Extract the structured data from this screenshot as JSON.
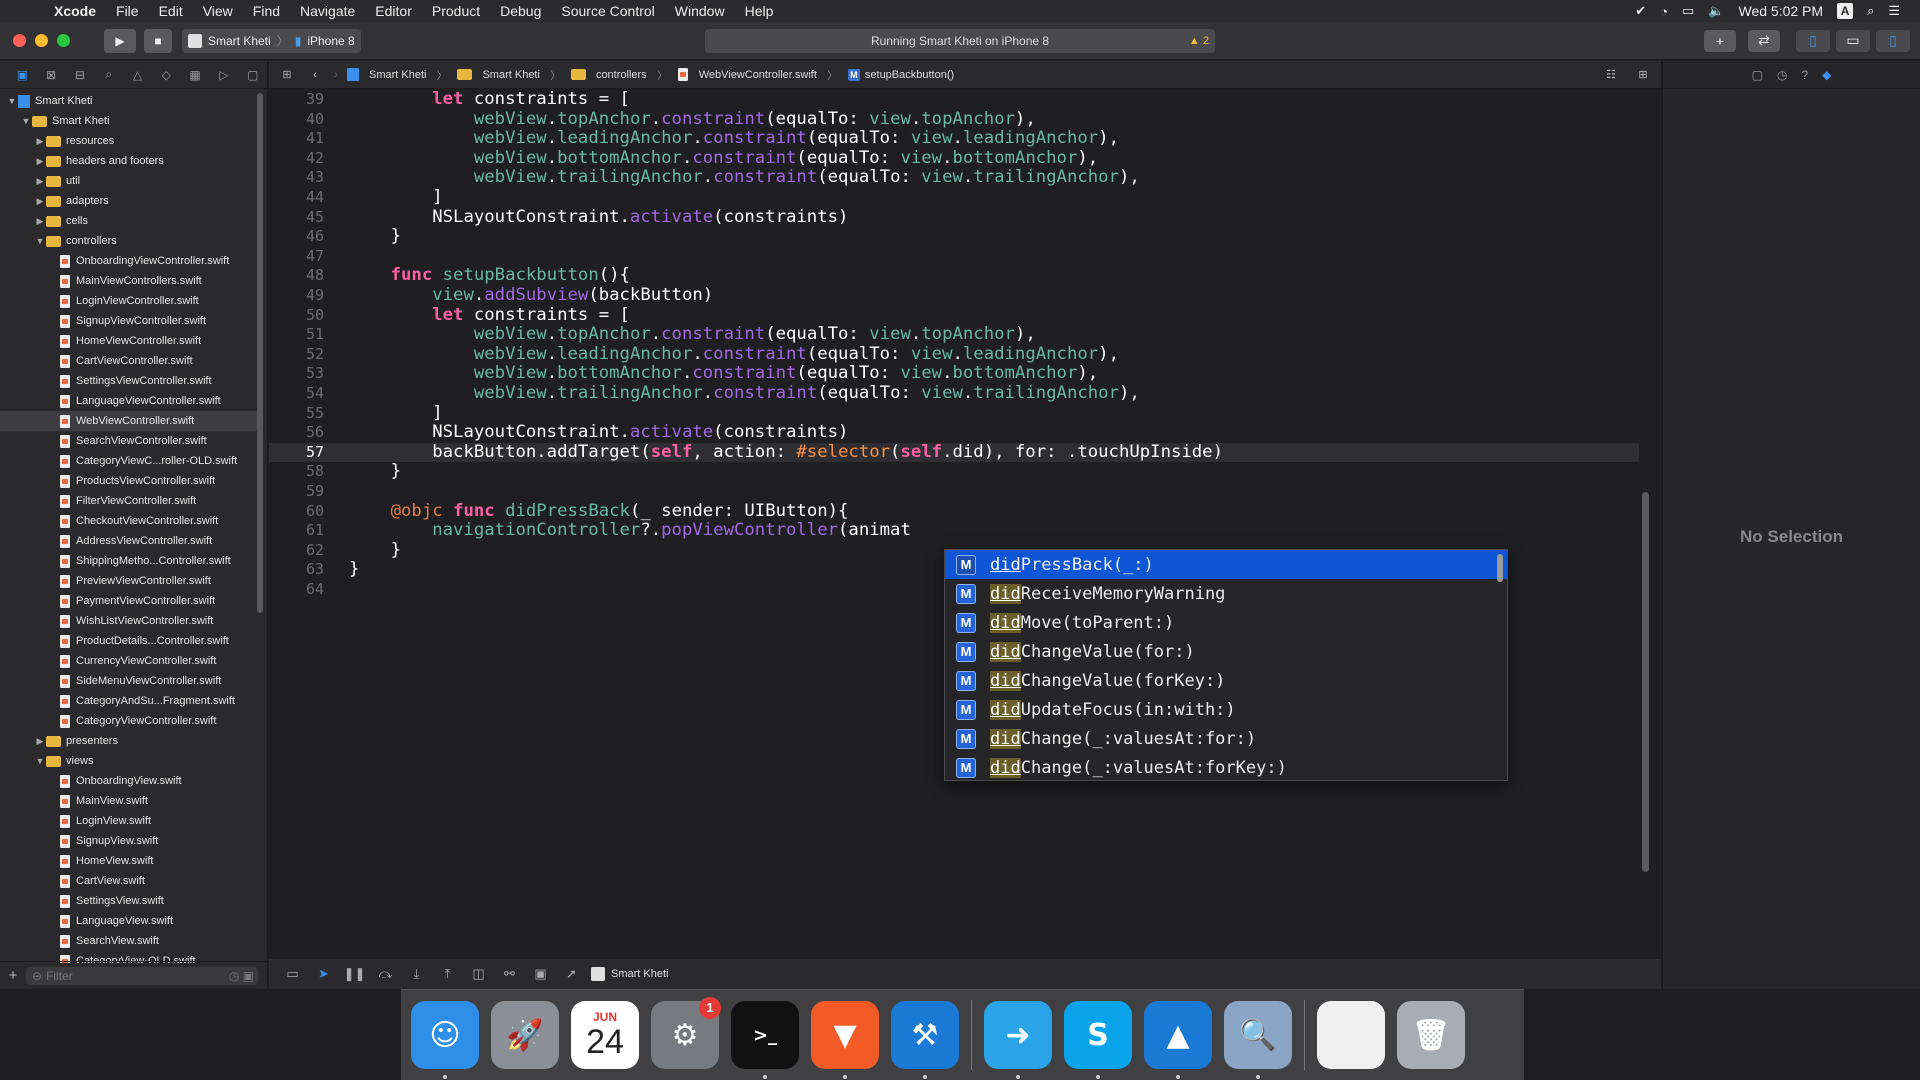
{
  "menubar": {
    "items": [
      "Xcode",
      "File",
      "Edit",
      "View",
      "Find",
      "Navigate",
      "Editor",
      "Product",
      "Debug",
      "Source Control",
      "Window",
      "Help"
    ],
    "clock": "Wed 5:02 PM",
    "input_source": "A"
  },
  "toolbar": {
    "scheme": "Smart Kheti",
    "device": "iPhone 8",
    "status": "Running Smart Kheti on iPhone 8",
    "warnings": "2"
  },
  "jumpbar": {
    "crumbs": [
      "Smart Kheti",
      "Smart Kheti",
      "controllers",
      "WebViewController.swift",
      "setupBackbutton()"
    ]
  },
  "navigator": {
    "tree": [
      {
        "label": "Smart Kheti",
        "kind": "project",
        "depth": 0,
        "open": true
      },
      {
        "label": "Smart Kheti",
        "kind": "folder",
        "depth": 1,
        "open": true
      },
      {
        "label": "resources",
        "kind": "folder",
        "depth": 2,
        "open": false
      },
      {
        "label": "headers and footers",
        "kind": "folder",
        "depth": 2,
        "open": false
      },
      {
        "label": "util",
        "kind": "folder",
        "depth": 2,
        "open": false
      },
      {
        "label": "adapters",
        "kind": "folder",
        "depth": 2,
        "open": false
      },
      {
        "label": "cells",
        "kind": "folder",
        "depth": 2,
        "open": false
      },
      {
        "label": "controllers",
        "kind": "folder",
        "depth": 2,
        "open": true
      },
      {
        "label": "OnboardingViewController.swift",
        "kind": "file",
        "depth": 3
      },
      {
        "label": "MainViewControllers.swift",
        "kind": "file",
        "depth": 3
      },
      {
        "label": "LoginViewController.swift",
        "kind": "file",
        "depth": 3
      },
      {
        "label": "SignupViewController.swift",
        "kind": "file",
        "depth": 3
      },
      {
        "label": "HomeViewController.swift",
        "kind": "file",
        "depth": 3
      },
      {
        "label": "CartViewController.swift",
        "kind": "file",
        "depth": 3
      },
      {
        "label": "SettingsViewController.swift",
        "kind": "file",
        "depth": 3
      },
      {
        "label": "LanguageViewController.swift",
        "kind": "file",
        "depth": 3
      },
      {
        "label": "WebViewController.swift",
        "kind": "file",
        "depth": 3,
        "selected": true
      },
      {
        "label": "SearchViewController.swift",
        "kind": "file",
        "depth": 3
      },
      {
        "label": "CategoryViewC...roller-OLD.swift",
        "kind": "file",
        "depth": 3
      },
      {
        "label": "ProductsViewController.swift",
        "kind": "file",
        "depth": 3
      },
      {
        "label": "FilterViewController.swift",
        "kind": "file",
        "depth": 3
      },
      {
        "label": "CheckoutViewController.swift",
        "kind": "file",
        "depth": 3
      },
      {
        "label": "AddressViewController.swift",
        "kind": "file",
        "depth": 3
      },
      {
        "label": "ShippingMetho...Controller.swift",
        "kind": "file",
        "depth": 3
      },
      {
        "label": "PreviewViewController.swift",
        "kind": "file",
        "depth": 3
      },
      {
        "label": "PaymentViewController.swift",
        "kind": "file",
        "depth": 3
      },
      {
        "label": "WishListViewController.swift",
        "kind": "file",
        "depth": 3
      },
      {
        "label": "ProductDetails...Controller.swift",
        "kind": "file",
        "depth": 3
      },
      {
        "label": "CurrencyViewController.swift",
        "kind": "file",
        "depth": 3
      },
      {
        "label": "SideMenuViewController.swift",
        "kind": "file",
        "depth": 3
      },
      {
        "label": "CategoryAndSu...Fragment.swift",
        "kind": "file",
        "depth": 3
      },
      {
        "label": "CategoryViewController.swift",
        "kind": "file",
        "depth": 3
      },
      {
        "label": "presenters",
        "kind": "folder",
        "depth": 2,
        "open": false
      },
      {
        "label": "views",
        "kind": "folder",
        "depth": 2,
        "open": true
      },
      {
        "label": "OnboardingView.swift",
        "kind": "file",
        "depth": 3
      },
      {
        "label": "MainView.swift",
        "kind": "file",
        "depth": 3
      },
      {
        "label": "LoginView.swift",
        "kind": "file",
        "depth": 3
      },
      {
        "label": "SignupView.swift",
        "kind": "file",
        "depth": 3
      },
      {
        "label": "HomeView.swift",
        "kind": "file",
        "depth": 3
      },
      {
        "label": "CartView.swift",
        "kind": "file",
        "depth": 3
      },
      {
        "label": "SettingsView.swift",
        "kind": "file",
        "depth": 3
      },
      {
        "label": "LanguageView.swift",
        "kind": "file",
        "depth": 3
      },
      {
        "label": "SearchView.swift",
        "kind": "file",
        "depth": 3
      },
      {
        "label": "CategoryView-OLD.swift",
        "kind": "file",
        "depth": 3
      }
    ],
    "filter_placeholder": "Filter"
  },
  "editor": {
    "current_line": 57,
    "lines": [
      {
        "n": 39,
        "tokens": [
          [
            "        ",
            ""
          ],
          [
            "let",
            "kw"
          ],
          [
            " constraints = [",
            ""
          ]
        ]
      },
      {
        "n": 40,
        "tokens": [
          [
            "            ",
            ""
          ],
          [
            "webView",
            "prop"
          ],
          [
            ".",
            ""
          ],
          [
            "topAnchor",
            "prop"
          ],
          [
            ".",
            ""
          ],
          [
            "constraint",
            "call"
          ],
          [
            "(equalTo: ",
            ""
          ],
          [
            "view",
            "prop"
          ],
          [
            ".",
            ""
          ],
          [
            "topAnchor",
            "prop"
          ],
          [
            "),",
            ""
          ]
        ]
      },
      {
        "n": 41,
        "tokens": [
          [
            "            ",
            ""
          ],
          [
            "webView",
            "prop"
          ],
          [
            ".",
            ""
          ],
          [
            "leadingAnchor",
            "prop"
          ],
          [
            ".",
            ""
          ],
          [
            "constraint",
            "call"
          ],
          [
            "(equalTo: ",
            ""
          ],
          [
            "view",
            "prop"
          ],
          [
            ".",
            ""
          ],
          [
            "leadingAnchor",
            "prop"
          ],
          [
            "),",
            ""
          ]
        ]
      },
      {
        "n": 42,
        "tokens": [
          [
            "            ",
            ""
          ],
          [
            "webView",
            "prop"
          ],
          [
            ".",
            ""
          ],
          [
            "bottomAnchor",
            "prop"
          ],
          [
            ".",
            ""
          ],
          [
            "constraint",
            "call"
          ],
          [
            "(equalTo: ",
            ""
          ],
          [
            "view",
            "prop"
          ],
          [
            ".",
            ""
          ],
          [
            "bottomAnchor",
            "prop"
          ],
          [
            "),",
            ""
          ]
        ]
      },
      {
        "n": 43,
        "tokens": [
          [
            "            ",
            ""
          ],
          [
            "webView",
            "prop"
          ],
          [
            ".",
            ""
          ],
          [
            "trailingAnchor",
            "prop"
          ],
          [
            ".",
            ""
          ],
          [
            "constraint",
            "call"
          ],
          [
            "(equalTo: ",
            ""
          ],
          [
            "view",
            "prop"
          ],
          [
            ".",
            ""
          ],
          [
            "trailingAnchor",
            "prop"
          ],
          [
            "),",
            ""
          ]
        ]
      },
      {
        "n": 44,
        "tokens": [
          [
            "        ]",
            ""
          ]
        ]
      },
      {
        "n": 45,
        "tokens": [
          [
            "        NSLayoutConstraint.",
            ""
          ],
          [
            "activate",
            "call"
          ],
          [
            "(constraints)",
            ""
          ]
        ]
      },
      {
        "n": 46,
        "tokens": [
          [
            "    }",
            ""
          ]
        ]
      },
      {
        "n": 47,
        "tokens": [
          [
            "",
            ""
          ]
        ]
      },
      {
        "n": 48,
        "tokens": [
          [
            "    ",
            ""
          ],
          [
            "func",
            "kw"
          ],
          [
            " ",
            ""
          ],
          [
            "setupBackbutton",
            "fn"
          ],
          [
            "(){",
            ""
          ]
        ]
      },
      {
        "n": 49,
        "tokens": [
          [
            "        ",
            ""
          ],
          [
            "view",
            "prop"
          ],
          [
            ".",
            ""
          ],
          [
            "addSubview",
            "call"
          ],
          [
            "(backButton)",
            ""
          ]
        ]
      },
      {
        "n": 50,
        "tokens": [
          [
            "        ",
            ""
          ],
          [
            "let",
            "kw"
          ],
          [
            " constraints = [",
            ""
          ]
        ]
      },
      {
        "n": 51,
        "tokens": [
          [
            "            ",
            ""
          ],
          [
            "webView",
            "prop"
          ],
          [
            ".",
            ""
          ],
          [
            "topAnchor",
            "prop"
          ],
          [
            ".",
            ""
          ],
          [
            "constraint",
            "call"
          ],
          [
            "(equalTo: ",
            ""
          ],
          [
            "view",
            "prop"
          ],
          [
            ".",
            ""
          ],
          [
            "topAnchor",
            "prop"
          ],
          [
            "),",
            ""
          ]
        ]
      },
      {
        "n": 52,
        "tokens": [
          [
            "            ",
            ""
          ],
          [
            "webView",
            "prop"
          ],
          [
            ".",
            ""
          ],
          [
            "leadingAnchor",
            "prop"
          ],
          [
            ".",
            ""
          ],
          [
            "constraint",
            "call"
          ],
          [
            "(equalTo: ",
            ""
          ],
          [
            "view",
            "prop"
          ],
          [
            ".",
            ""
          ],
          [
            "leadingAnchor",
            "prop"
          ],
          [
            "),",
            ""
          ]
        ]
      },
      {
        "n": 53,
        "tokens": [
          [
            "            ",
            ""
          ],
          [
            "webView",
            "prop"
          ],
          [
            ".",
            ""
          ],
          [
            "bottomAnchor",
            "prop"
          ],
          [
            ".",
            ""
          ],
          [
            "constraint",
            "call"
          ],
          [
            "(equalTo: ",
            ""
          ],
          [
            "view",
            "prop"
          ],
          [
            ".",
            ""
          ],
          [
            "bottomAnchor",
            "prop"
          ],
          [
            "),",
            ""
          ]
        ]
      },
      {
        "n": 54,
        "tokens": [
          [
            "            ",
            ""
          ],
          [
            "webView",
            "prop"
          ],
          [
            ".",
            ""
          ],
          [
            "trailingAnchor",
            "prop"
          ],
          [
            ".",
            ""
          ],
          [
            "constraint",
            "call"
          ],
          [
            "(equalTo: ",
            ""
          ],
          [
            "view",
            "prop"
          ],
          [
            ".",
            ""
          ],
          [
            "trailingAnchor",
            "prop"
          ],
          [
            "),",
            ""
          ]
        ]
      },
      {
        "n": 55,
        "tokens": [
          [
            "        ]",
            ""
          ]
        ]
      },
      {
        "n": 56,
        "tokens": [
          [
            "        NSLayoutConstraint.",
            ""
          ],
          [
            "activate",
            "call"
          ],
          [
            "(constraints)",
            ""
          ]
        ]
      },
      {
        "n": 57,
        "tokens": [
          [
            "        backButton.addTarget(",
            ""
          ],
          [
            "self",
            "kw"
          ],
          [
            ", action: ",
            ""
          ],
          [
            "#selector",
            "macro"
          ],
          [
            "(",
            ""
          ],
          [
            "self",
            "kw"
          ],
          [
            ".did), for: .touchUpInside)",
            ""
          ]
        ]
      },
      {
        "n": 58,
        "tokens": [
          [
            "    }",
            ""
          ]
        ]
      },
      {
        "n": 59,
        "tokens": [
          [
            "",
            ""
          ]
        ]
      },
      {
        "n": 60,
        "tokens": [
          [
            "    ",
            ""
          ],
          [
            "@objc",
            "attr"
          ],
          [
            " ",
            ""
          ],
          [
            "func",
            "kw"
          ],
          [
            " ",
            ""
          ],
          [
            "didPressBack",
            "fn"
          ],
          [
            "(_ sender: UIButton){",
            ""
          ]
        ]
      },
      {
        "n": 61,
        "tokens": [
          [
            "        ",
            ""
          ],
          [
            "navigationController",
            "prop"
          ],
          [
            "?.",
            ""
          ],
          [
            "popViewController",
            "call"
          ],
          [
            "(animat",
            ""
          ]
        ]
      },
      {
        "n": 62,
        "tokens": [
          [
            "    }",
            ""
          ]
        ]
      },
      {
        "n": 63,
        "tokens": [
          [
            "}",
            ""
          ]
        ]
      },
      {
        "n": 64,
        "tokens": [
          [
            "",
            ""
          ]
        ]
      }
    ]
  },
  "autocomplete": {
    "typed_prefix": "did",
    "items": [
      {
        "kind": "M",
        "rest": "PressBack(_:)",
        "selected": true
      },
      {
        "kind": "M",
        "rest": "ReceiveMemoryWarning"
      },
      {
        "kind": "M",
        "rest": "Move(toParent:)"
      },
      {
        "kind": "M",
        "rest": "ChangeValue(for:)"
      },
      {
        "kind": "M",
        "rest": "ChangeValue(forKey:)"
      },
      {
        "kind": "M",
        "rest": "UpdateFocus(in:with:)"
      },
      {
        "kind": "M",
        "rest": "Change(_:valuesAt:for:)"
      },
      {
        "kind": "M",
        "rest": "Change(_:valuesAt:forKey:)"
      }
    ]
  },
  "debugbar": {
    "target": "Smart Kheti"
  },
  "inspector": {
    "empty_text": "No Selection"
  },
  "dock": {
    "items": [
      {
        "name": "Finder",
        "color": "#2f8fe8",
        "glyph": "☺",
        "running": true
      },
      {
        "name": "Launchpad",
        "color": "#8a8f98",
        "glyph": "🚀",
        "running": false
      },
      {
        "name": "Calendar",
        "color": "#ffffff",
        "glyph": "",
        "running": false,
        "month": "JUN",
        "day": "24"
      },
      {
        "name": "System Preferences",
        "color": "#777b80",
        "glyph": "⚙",
        "running": false,
        "badge": "1"
      },
      {
        "name": "Terminal",
        "color": "#111111",
        "glyph": ">_",
        "running": true
      },
      {
        "name": "Brave",
        "color": "#f25b25",
        "glyph": "▼",
        "running": true
      },
      {
        "name": "Xcode",
        "color": "#1b7ad6",
        "glyph": "⚒",
        "running": true
      },
      {
        "name": "Migration",
        "color": "#2aa4e6",
        "glyph": "➜",
        "running": true
      },
      {
        "name": "Skype",
        "color": "#0aa4ed",
        "glyph": "S",
        "running": true
      },
      {
        "name": "Simulator",
        "color": "#1b7ad6",
        "glyph": "▲",
        "running": true
      },
      {
        "name": "Preview",
        "color": "#8aa5c5",
        "glyph": "🔍",
        "running": true
      },
      {
        "name": "Documents",
        "color": "#f0f0f0",
        "glyph": "",
        "running": false
      },
      {
        "name": "Trash",
        "color": "#a7adb3",
        "glyph": "🗑",
        "running": false
      }
    ]
  }
}
